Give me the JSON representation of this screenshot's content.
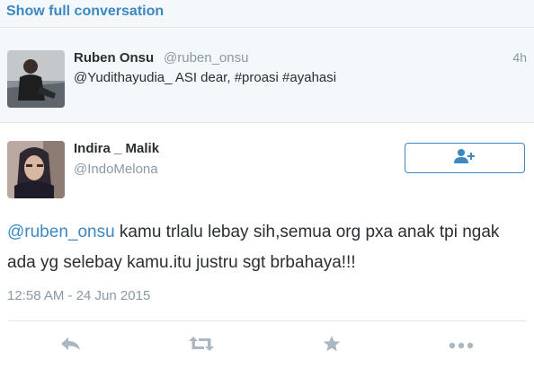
{
  "conversation": {
    "show_full_label": "Show full conversation"
  },
  "reply_tweet": {
    "name": "Ruben Onsu",
    "handle": "@ruben_onsu",
    "time_ago": "4h",
    "text": "@Yudithayudia_ ASI dear, #proasi #ayahasi"
  },
  "main_tweet": {
    "name": "Indira _ Malik",
    "handle": "@IndoMelona",
    "mention": "@ruben_onsu",
    "text": " kamu trlalu lebay sih,semua org pxa anak tpi ngak ada yg selebay kamu.itu justru sgt brbahaya!!!",
    "timestamp": "12:58 AM - 24 Jun 2015"
  },
  "icons": {
    "follow": "add-user-icon",
    "reply": "reply-icon",
    "retweet": "retweet-icon",
    "favorite": "star-icon",
    "more": "more-icon"
  },
  "colors": {
    "accent": "#3b88c3",
    "muted": "#8899a6",
    "text": "#292f33",
    "action_icon": "#aab8c2"
  }
}
